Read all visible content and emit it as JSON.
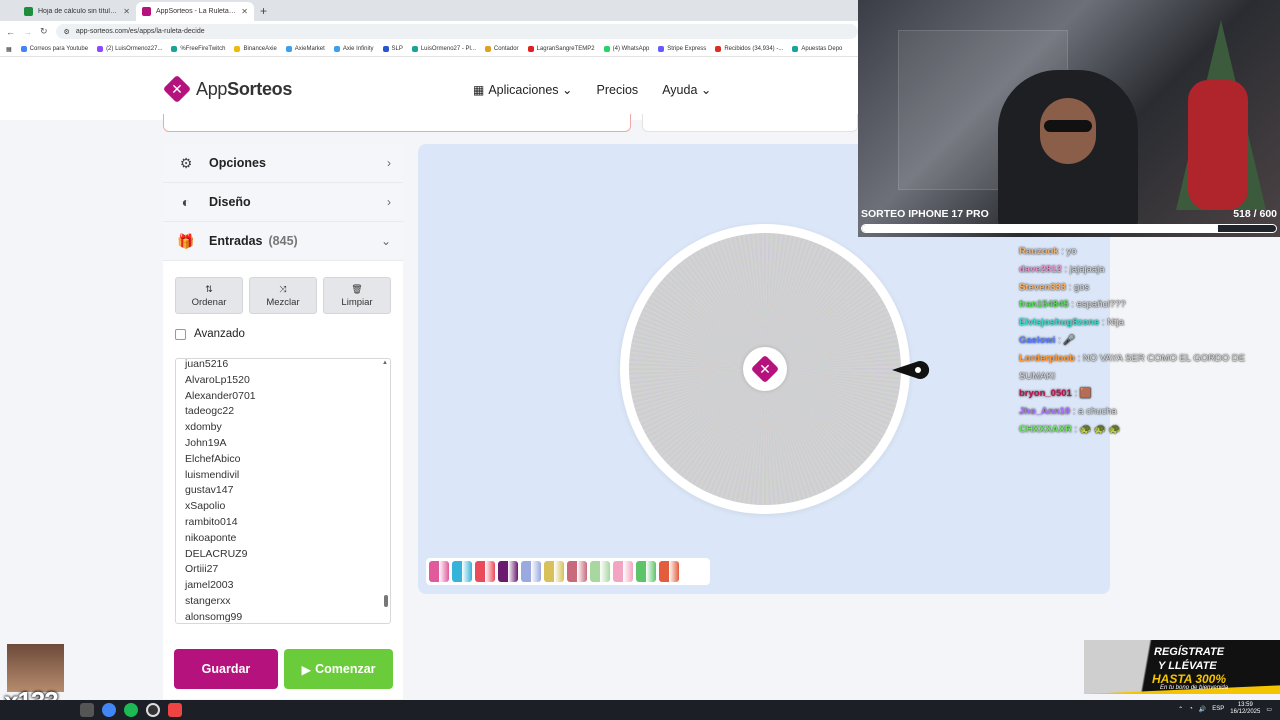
{
  "browser": {
    "tabs": [
      {
        "title": "Hoja de cálculo sin título - Hoja",
        "favicon_color": "#1e8e3e",
        "active": false
      },
      {
        "title": "AppSorteos - La Ruleta de la Suerte",
        "favicon_color": "#b5127e",
        "active": true
      }
    ],
    "url": "app-sorteos.com/es/apps/la-ruleta-decide",
    "bookmarks": [
      "Correos para Youtube",
      "(2) LuisOrmenoz27...",
      "%FreeFireTwitch",
      "BinanceAxie",
      "AxieMarket",
      "Axie Infinity",
      "SLP",
      "LuisOrmeno27 - Pl...",
      "Contador",
      "LagranSangreTEMP2",
      "(4) WhatsApp",
      "Stripe Express",
      "Recibidos (34,934) -...",
      "Apuestas Depo"
    ]
  },
  "site": {
    "logo_part1": "App",
    "logo_part2": "Sorteos",
    "nav": [
      "Aplicaciones",
      "Precios",
      "Ayuda"
    ]
  },
  "panel": {
    "sections": {
      "opciones": "Opciones",
      "diseno": "Diseño",
      "entradas": "Entradas",
      "entradas_count": "(845)"
    },
    "tools": {
      "ordenar": "Ordenar",
      "mezclar": "Mezclar",
      "limpiar": "Limpiar"
    },
    "avanzado": "Avanzado",
    "entries": [
      "juan5216",
      "AlvaroLp1520",
      "Alexander0701",
      "tadeogc22",
      "xdomby",
      "John19A",
      "ElchefAbico",
      "luismendivil",
      "gustav147",
      "xSapolio",
      "rambito014",
      "nikoaponte",
      "DELACRUZ9",
      "Ortiii27",
      "jamel2003",
      "stangerxx",
      "alonsomg99"
    ],
    "guardar": "Guardar",
    "comenzar": "Comenzar"
  },
  "palette": [
    "#e05a9c",
    "#36b3d9",
    "#e94b5a",
    "#6a1b6e",
    "#9aa9e0",
    "#d8c05a",
    "#c86a7b",
    "#a8d8a0",
    "#f2a5c0",
    "#5ec46a",
    "#e35d3c"
  ],
  "stream": {
    "title": "SORTEO IPHONE 17 PRO",
    "counter": "518  / 600",
    "progress": 0.86,
    "chat": [
      {
        "user": "Rauzook",
        "color": "#e8b27a",
        "msg": "yo"
      },
      {
        "user": "dave2812",
        "color": "#f08bd0",
        "msg": "jajajaaja"
      },
      {
        "user": "Steven333",
        "color": "#ffb060",
        "msg": "gos"
      },
      {
        "user": "fran154845",
        "color": "#55dd55",
        "msg": "español???"
      },
      {
        "user": "Elvisjoshug8zone",
        "color": "#3ad8c8",
        "msg": "Ntja"
      },
      {
        "user": "Gaelowi",
        "color": "#5a7fff",
        "msg": "🎤"
      },
      {
        "user": "Lorderploob",
        "color": "#ff9a3a",
        "msg": "NO VAYA SER COMO EL GORDO DE SUMAKI"
      },
      {
        "user": "bryon_0501",
        "color": "#c01050",
        "msg": "🟫"
      },
      {
        "user": "Jho_Ann10",
        "color": "#b070ff",
        "msg": "a chucha"
      },
      {
        "user": "CHXXXAXR",
        "color": "#6be85a",
        "msg": "🐢 🐢 🐢"
      }
    ]
  },
  "overlay": {
    "multiplier": "x133",
    "ad_line1": "REGÍSTRATE",
    "ad_line2": "Y LLÉVATE",
    "ad_line3": "HASTA 300%",
    "ad_line4": "En tu bono de bienvenida"
  },
  "taskbar": {
    "lang": "ESP",
    "time": "13:59",
    "date": "16/12/2025"
  }
}
